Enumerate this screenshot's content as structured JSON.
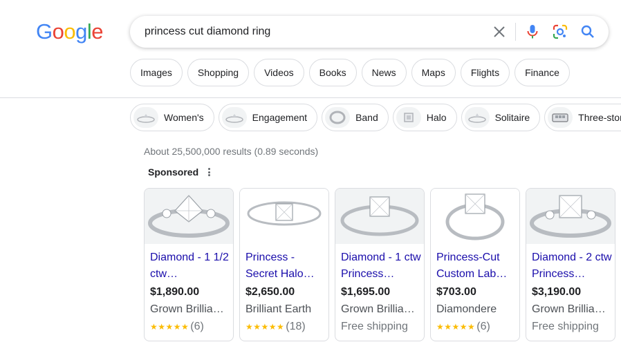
{
  "logo": {
    "letters": [
      "G",
      "o",
      "o",
      "g",
      "l",
      "e"
    ],
    "colors": [
      "#4285F4",
      "#EA4335",
      "#FBBC05",
      "#4285F4",
      "#34A853",
      "#EA4335"
    ]
  },
  "search": {
    "query": "princess cut diamond ring"
  },
  "icons": {
    "clear": "close-icon",
    "voice": "microphone-icon",
    "lens": "camera-lens-icon",
    "search": "search-icon"
  },
  "tabs": [
    "Images",
    "Shopping",
    "Videos",
    "Books",
    "News",
    "Maps",
    "Flights",
    "Finance"
  ],
  "chips": [
    "Women's",
    "Engagement",
    "Band",
    "Halo",
    "Solitaire",
    "Three-stone"
  ],
  "stats": "About 25,500,000 results (0.89 seconds)",
  "sponsored": "Sponsored",
  "products": [
    {
      "title": "Diamond - 1 1/2 ctw…",
      "price": "$1,890.00",
      "merchant": "Grown Brillia…",
      "rating": "★★★★★",
      "reviews": "(6)",
      "shipping": ""
    },
    {
      "title": "Princess - Secret Halo…",
      "price": "$2,650.00",
      "merchant": "Brilliant Earth",
      "rating": "★★★★★",
      "reviews": "(18)",
      "shipping": ""
    },
    {
      "title": "Diamond - 1 ctw Princess…",
      "price": "$1,695.00",
      "merchant": "Grown Brillia…",
      "rating": "",
      "reviews": "",
      "shipping": "Free shipping"
    },
    {
      "title": "Princess-Cut Custom Lab…",
      "price": "$703.00",
      "merchant": "Diamondere",
      "rating": "★★★★★",
      "reviews": "(6)",
      "shipping": ""
    },
    {
      "title": "Diamond - 2 ctw Princess…",
      "price": "$3,190.00",
      "merchant": "Grown Brillia…",
      "rating": "",
      "reviews": "",
      "shipping": "Free shipping"
    }
  ],
  "colors": {
    "link": "#1a0dab",
    "star": "#fbbc04",
    "border": "#dadce0",
    "search_blue": "#4285F4"
  }
}
